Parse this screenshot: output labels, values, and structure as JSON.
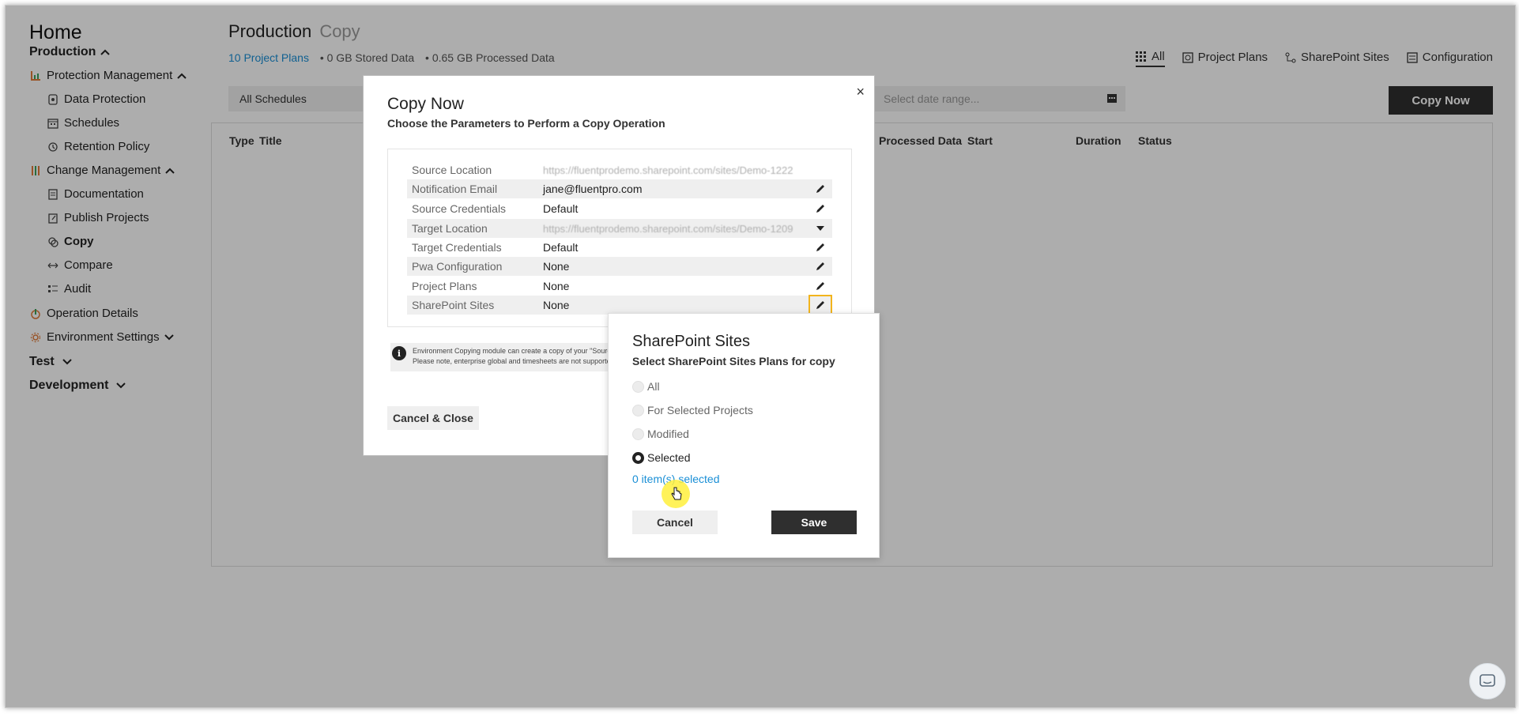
{
  "sidebar": {
    "home": "Home",
    "items": [
      {
        "label": "Production",
        "level": 0
      },
      {
        "label": "Protection Management",
        "level": 1
      },
      {
        "label": "Data Protection",
        "level": 2
      },
      {
        "label": "Schedules",
        "level": 2
      },
      {
        "label": "Retention Policy",
        "level": 2
      },
      {
        "label": "Change Management",
        "level": 1
      },
      {
        "label": "Documentation",
        "level": 2
      },
      {
        "label": "Publish Projects",
        "level": 2
      },
      {
        "label": "Copy",
        "level": 2,
        "active": true
      },
      {
        "label": "Compare",
        "level": 2
      },
      {
        "label": "Audit",
        "level": 2
      },
      {
        "label": "Operation Details",
        "level": 1
      },
      {
        "label": "Environment Settings",
        "level": 1
      },
      {
        "label": "Test",
        "level": 0
      },
      {
        "label": "Development",
        "level": 0
      }
    ]
  },
  "header": {
    "title": "Production",
    "subtitle": "Copy",
    "stats": {
      "plans": "10 Project Plans",
      "stored": "• 0 GB Stored Data",
      "processed": "• 0.65 GB Processed Data"
    },
    "views": [
      "All",
      "Project Plans",
      "SharePoint Sites",
      "Configuration"
    ],
    "selected_view": "All"
  },
  "toolbar": {
    "schedule_filter": "All Schedules",
    "date_placeholder": "Select date range...",
    "copy_now_label": "Copy Now"
  },
  "table": {
    "columns": [
      "Type",
      "Title",
      "Processed Data",
      "Start",
      "Duration",
      "Status"
    ]
  },
  "copy_modal": {
    "title": "Copy Now",
    "subtitle": "Choose the Parameters to Perform a Copy Operation",
    "close": "×",
    "params": [
      {
        "key": "Source Location",
        "value": "https://fluentprodemo.sharepoint.com/sites/Demo-1222"
      },
      {
        "key": "Notification Email",
        "value": "jane@fluentpro.com"
      },
      {
        "key": "Source Credentials",
        "value": "Default"
      },
      {
        "key": "Target Location",
        "value": "https://fluentprodemo.sharepoint.com/sites/Demo-1209"
      },
      {
        "key": "Target Credentials",
        "value": "Default"
      },
      {
        "key": "Pwa Configuration",
        "value": "None"
      },
      {
        "key": "Project Plans",
        "value": "None"
      },
      {
        "key": "SharePoint Sites",
        "value": "None"
      }
    ],
    "info_line1": "Environment Copying module can create a copy of your \"Source\" En",
    "info_line2": "Please note, enterprise global and timesheets are not supported.",
    "cancel_close": "Cancel & Close"
  },
  "sp_popup": {
    "title": "SharePoint Sites",
    "subtitle": "Select SharePoint Sites Plans for copy",
    "options": [
      "All",
      "For Selected Projects",
      "Modified",
      "Selected"
    ],
    "selected_option": "Selected",
    "selection_link": "0 item(s) selected",
    "cancel": "Cancel",
    "save": "Save"
  },
  "colors": {
    "accent": "#1a8fd6",
    "dark_button": "#2f2f2f",
    "highlight": "#f2b41d",
    "cursor_highlight": "#fff03c"
  }
}
